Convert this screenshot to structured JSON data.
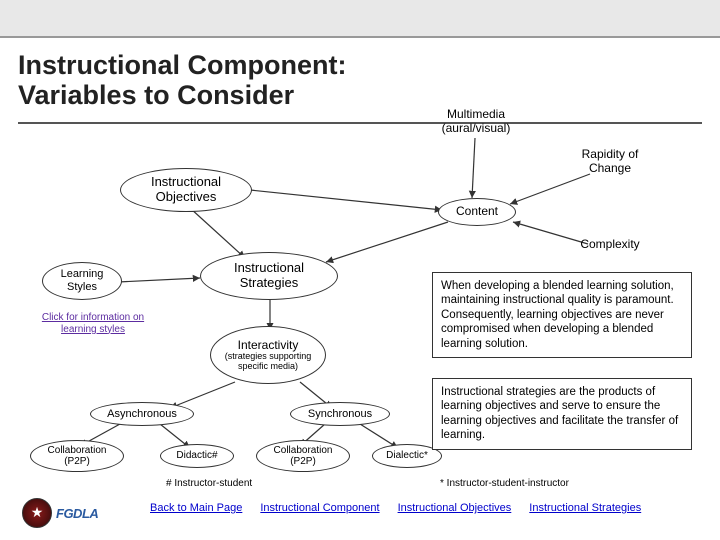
{
  "title": {
    "line1": "Instructional Component:",
    "line2": "Variables to Consider"
  },
  "nodes": {
    "multimedia": "Multimedia (aural/visual)",
    "rapidity": "Rapidity of Change",
    "instr_objectives": "Instructional Objectives",
    "content": "Content",
    "complexity": "Complexity",
    "instr_strategies": "Instructional Strategies",
    "learning_styles": "Learning Styles",
    "interactivity_title": "Interactivity",
    "interactivity_sub": "(strategies supporting specific media)",
    "asynchronous": "Asynchronous",
    "synchronous": "Synchronous",
    "collab_async": "Collaboration (P2P)",
    "didactic": "Didactic#",
    "collab_sync": "Collaboration (P2P)",
    "dialectic": "Dialectic*"
  },
  "links": {
    "learning_styles": "Click for information on learning styles"
  },
  "textboxes": {
    "para1": "When developing a blended learning solution, maintaining instructional quality is paramount.  Consequently, learning objectives are never compromised when developing a blended learning solution.",
    "para2": "Instructional strategies are the products of learning objectives and serve to ensure the learning objectives and facilitate the transfer of learning."
  },
  "footnotes": {
    "hash": "# Instructor-student",
    "star": "* Instructor-student-instructor"
  },
  "nav": {
    "back": "Back to Main Page",
    "comp": "Instructional Component",
    "obj": "Instructional Objectives",
    "strat": "Instructional Strategies"
  },
  "logo": {
    "text": "FGDLA"
  }
}
